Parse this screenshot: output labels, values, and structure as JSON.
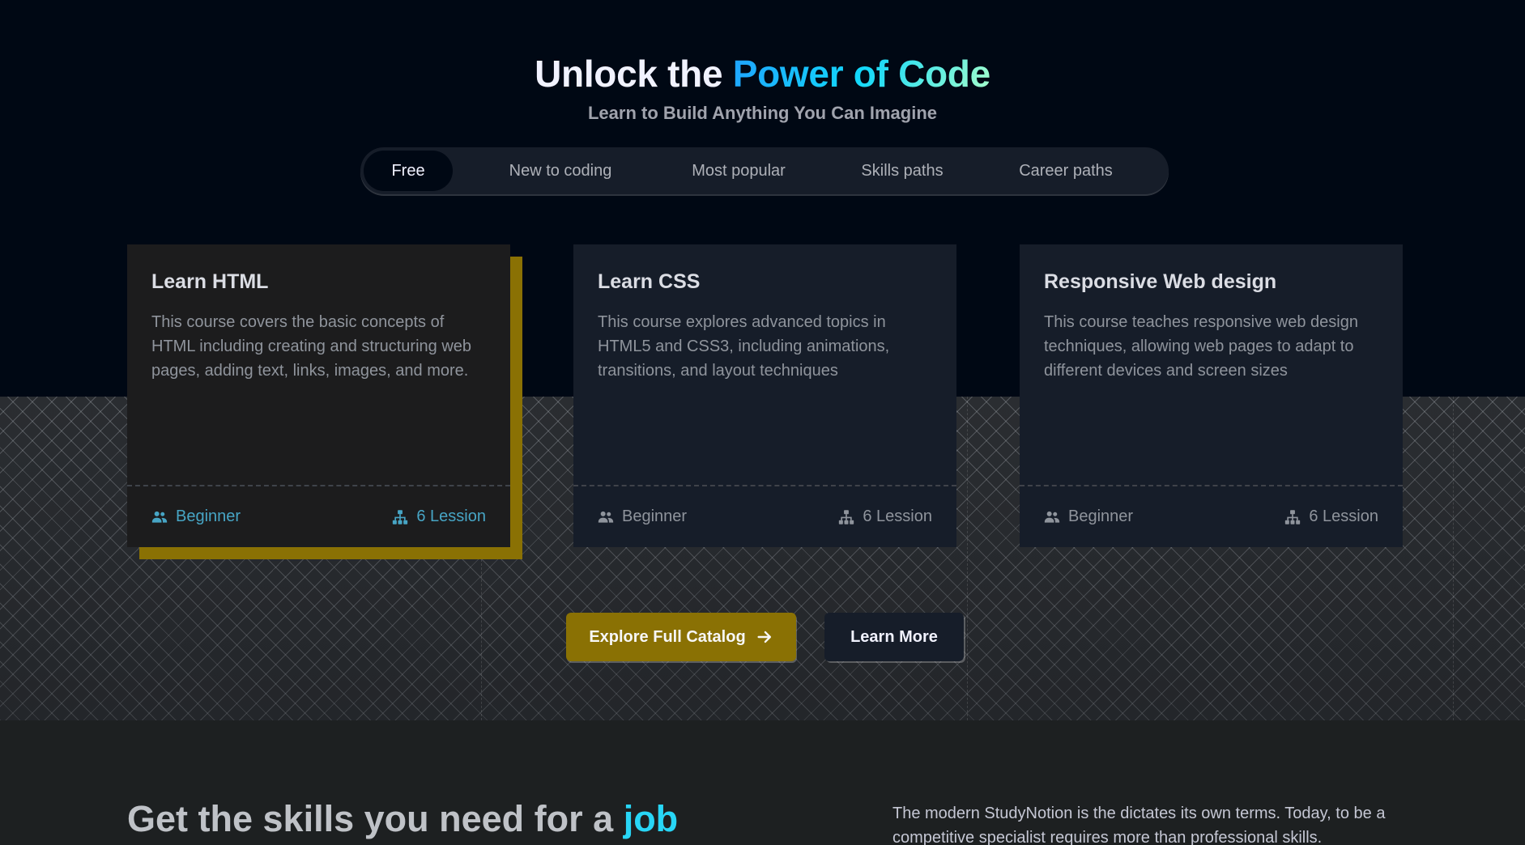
{
  "hero": {
    "title_prefix": "Unlock the",
    "title_accent": "Power of Code",
    "subtitle": "Learn to Build Anything You Can Imagine"
  },
  "tabs": [
    {
      "label": "Free",
      "active": true
    },
    {
      "label": "New to coding",
      "active": false
    },
    {
      "label": "Most popular",
      "active": false
    },
    {
      "label": "Skills paths",
      "active": false
    },
    {
      "label": "Career paths",
      "active": false
    }
  ],
  "cards": [
    {
      "title": "Learn HTML",
      "description": "This course covers the basic concepts of HTML including creating and structuring web pages, adding text, links, images, and more.",
      "level": "Beginner",
      "lessons": "6 Lession",
      "active": true
    },
    {
      "title": "Learn CSS",
      "description": "This course explores advanced topics in HTML5 and CSS3, including animations, transitions, and layout techniques",
      "level": "Beginner",
      "lessons": "6 Lession",
      "active": false
    },
    {
      "title": "Responsive Web design",
      "description": "This course teaches responsive web design techniques, allowing web pages to adapt to different devices and screen sizes",
      "level": "Beginner",
      "lessons": "6 Lession",
      "active": false
    }
  ],
  "buttons": {
    "explore": "Explore Full Catalog",
    "learn_more": "Learn More"
  },
  "skills": {
    "heading_prefix": "Get the skills you need for a",
    "heading_accent": "job",
    "paragraph": "The modern StudyNotion is the dictates its own terms. Today, to be a competitive specialist requires more than professional skills."
  },
  "colors": {
    "accent_cyan": "#12d8fa",
    "brand_yellow": "#8a7104",
    "background": "#000814"
  },
  "icons": {
    "level": "users-icon",
    "lessons": "hierarchy-icon",
    "explore": "arrow-right-icon"
  }
}
